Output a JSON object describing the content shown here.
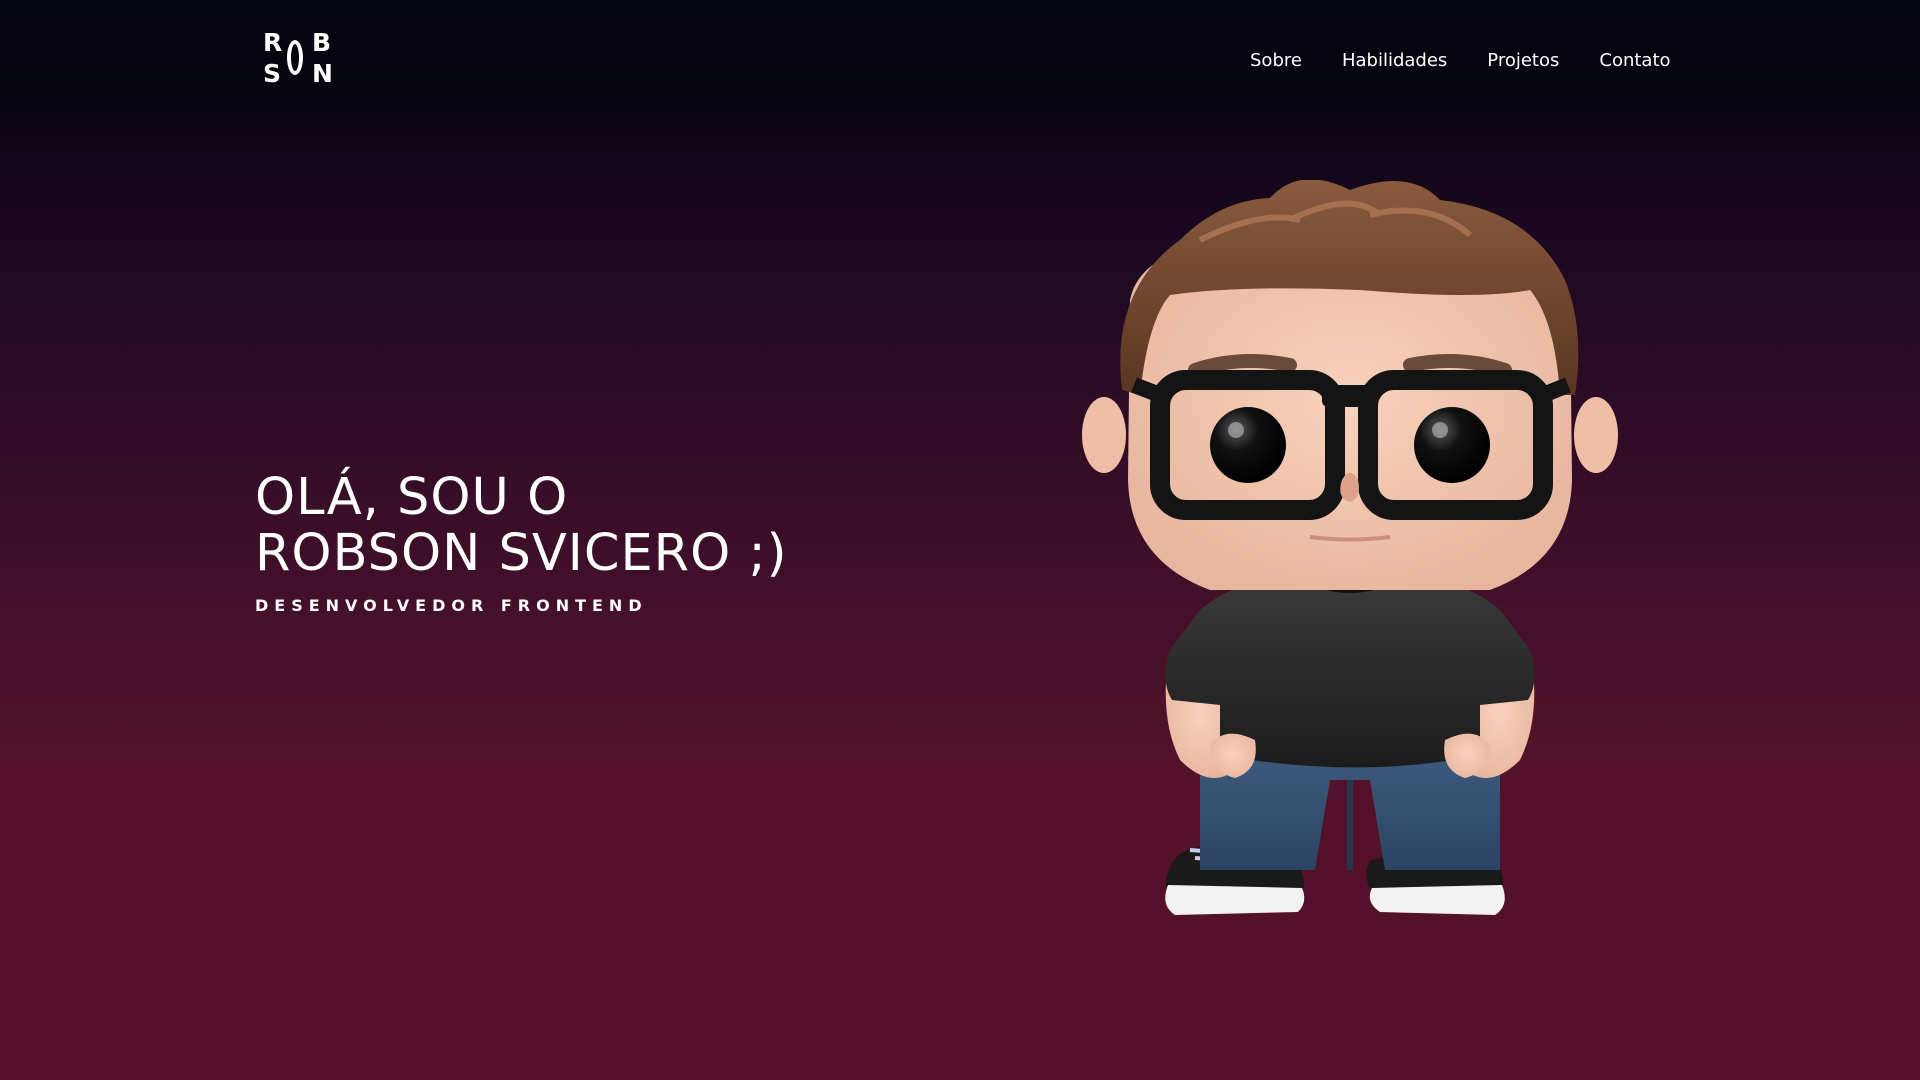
{
  "header": {
    "logo_text": "ROBSON",
    "logo_letters": [
      "R",
      "B",
      "S",
      "N"
    ],
    "nav": [
      {
        "label": "Sobre"
      },
      {
        "label": "Habilidades"
      },
      {
        "label": "Projetos"
      },
      {
        "label": "Contato"
      }
    ]
  },
  "hero": {
    "title_line1": "OLÁ, SOU O",
    "title_line2": "ROBSON SVICERO ;)",
    "subtitle": "DESENVOLVEDOR FRONTEND"
  },
  "colors": {
    "background_top": "#05040f",
    "background_bottom": "#531229",
    "text": "#ffffff"
  }
}
